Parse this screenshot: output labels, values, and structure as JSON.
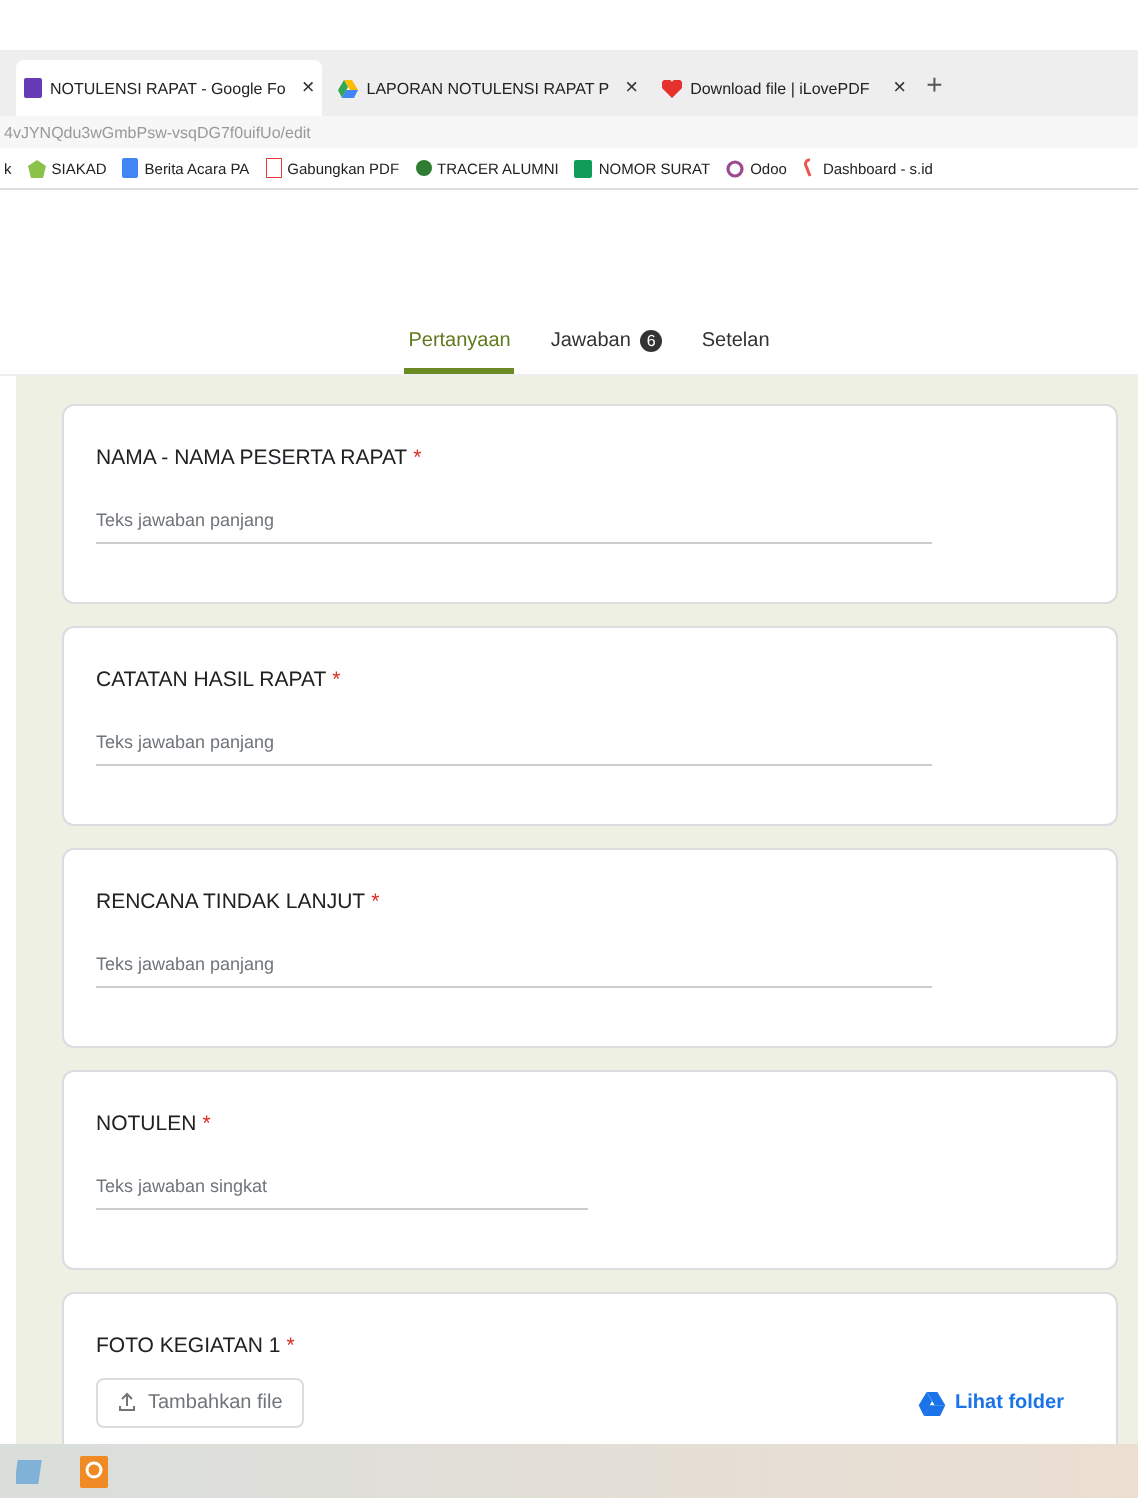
{
  "browser_tabs": [
    {
      "title": "NOTULENSI RAPAT - Google Fo",
      "close": "×",
      "selected": true
    },
    {
      "title": "LAPORAN NOTULENSI RAPAT P",
      "close": "×",
      "selected": false
    },
    {
      "title": "Download file | iLovePDF",
      "close": "×",
      "selected": false
    }
  ],
  "new_tab": "+",
  "address": "4vJYNQdu3wGmbPsw-vsqDG7f0uifUo/edit",
  "bookmarks": [
    {
      "label": "k"
    },
    {
      "label": "SIAKAD"
    },
    {
      "label": "Berita Acara PA"
    },
    {
      "label": "Gabungkan PDF"
    },
    {
      "label": "TRACER ALUMNI"
    },
    {
      "label": "NOMOR SURAT"
    },
    {
      "label": "Odoo"
    },
    {
      "label": "Dashboard - s.id"
    }
  ],
  "form_tabs": [
    {
      "label": "Pertanyaan",
      "selected": true
    },
    {
      "label": "Jawaban",
      "badge": "6",
      "selected": false
    },
    {
      "label": "Setelan",
      "selected": false
    }
  ],
  "questions": [
    {
      "kind": "text",
      "title": "NAMA - NAMA PESERTA RAPAT",
      "required_mark": "*",
      "placeholder": "Teks jawaban panjang",
      "long": true
    },
    {
      "kind": "text",
      "title": "CATATAN HASIL RAPAT",
      "required_mark": "*",
      "placeholder": "Teks jawaban panjang",
      "long": true
    },
    {
      "kind": "text",
      "title": "RENCANA TINDAK LANJUT",
      "required_mark": "*",
      "placeholder": "Teks jawaban panjang",
      "long": true
    },
    {
      "kind": "text",
      "title": "NOTULEN",
      "required_mark": "*",
      "placeholder": "Teks jawaban singkat",
      "long": false
    },
    {
      "kind": "file",
      "title": "FOTO KEGIATAN 1",
      "required_mark": "*",
      "button": "Tambahkan file",
      "link": "Lihat folder"
    }
  ]
}
